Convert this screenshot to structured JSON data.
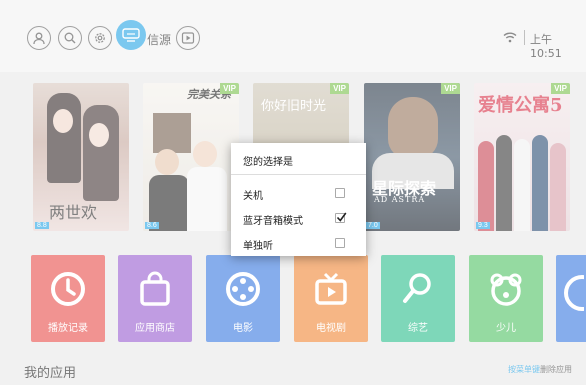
{
  "header": {
    "source_label": "信源",
    "time": "上午 10:51",
    "icons": [
      "user-icon",
      "search-icon",
      "settings-icon",
      "source-icon",
      "play-icon",
      "wifi-icon"
    ]
  },
  "posters": [
    {
      "title": "两世欢",
      "rating": "8.8",
      "vip": ""
    },
    {
      "title": "完美关系",
      "rating": "8.6",
      "vip": "VIP"
    },
    {
      "title": "你好旧时光",
      "rating": "",
      "vip": "VIP"
    },
    {
      "title": "星际探索",
      "subtitle": "AD ASTRA",
      "rating": "7.0",
      "vip": "VIP"
    },
    {
      "title": "爱情公寓5",
      "rating": "9.3",
      "vip": "VIP"
    }
  ],
  "tiles": [
    {
      "label": "播放记录",
      "color": "#e8514e"
    },
    {
      "label": "应用商店",
      "color": "#9a5fd0"
    },
    {
      "label": "电影",
      "color": "#3c7be0"
    },
    {
      "label": "电视剧",
      "color": "#f08a3a"
    },
    {
      "label": "综艺",
      "color": "#2fbf8f"
    },
    {
      "label": "少儿",
      "color": "#55c468"
    }
  ],
  "my_apps": {
    "title": "我的应用",
    "hint_key": "按菜单键",
    "hint_action": "删除应用"
  },
  "dialog": {
    "title": "您的选择是",
    "options": [
      {
        "label": "关机",
        "checked": false
      },
      {
        "label": "蓝牙音箱模式",
        "checked": true
      },
      {
        "label": "单独听",
        "checked": false
      }
    ]
  }
}
